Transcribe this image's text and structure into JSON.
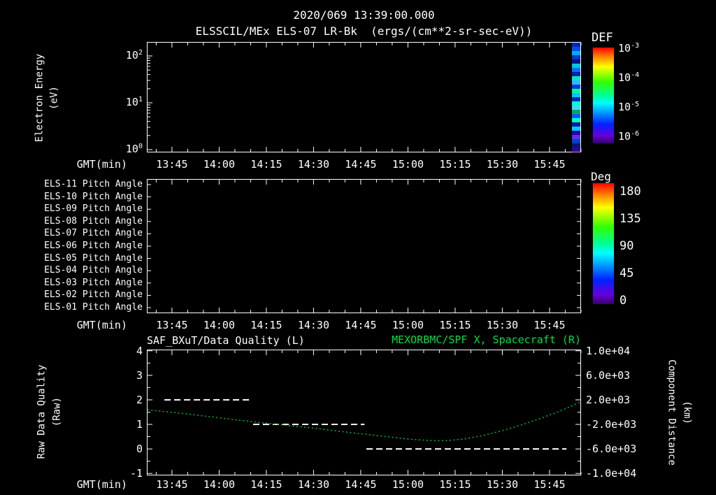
{
  "header": {
    "datetime": "2020/069 13:39:00.000",
    "title": "ELSSCIL/MEx ELS-07 LR-Bk  (ergs/(cm**2-sr-sec-eV))"
  },
  "colors": {
    "background": "#000000",
    "foreground": "#ffffff",
    "title_green": "#00e040",
    "curve_green": "#00b038",
    "rainbow_stops": [
      [
        "#ff0000",
        0
      ],
      [
        "#ff8800",
        10
      ],
      [
        "#ffff00",
        20
      ],
      [
        "#33ff00",
        36
      ],
      [
        "#00ff99",
        50
      ],
      [
        "#00ffff",
        58
      ],
      [
        "#0099ff",
        68
      ],
      [
        "#0022ff",
        80
      ],
      [
        "#6600dd",
        92
      ],
      [
        "#38006b",
        100
      ]
    ]
  },
  "x_axis": {
    "label": "GMT(min)",
    "tick_labels": [
      "13:45",
      "14:00",
      "14:15",
      "14:30",
      "14:45",
      "15:00",
      "15:15",
      "15:30",
      "15:45"
    ],
    "tick_hours": [
      13.75,
      14.0,
      14.25,
      14.5,
      14.75,
      15.0,
      15.25,
      15.5,
      15.75
    ],
    "start_hour": 13.617,
    "end_hour": 15.917
  },
  "spectrogram": {
    "ylabel_line1": "Electron Energy",
    "ylabel_line2": "(eV)",
    "ytick_exponents": [
      2,
      1,
      0
    ],
    "colorbar": {
      "title": "DEF",
      "tick_exponents": [
        -3,
        -4,
        -5,
        -6
      ]
    }
  },
  "pitch_panel": {
    "row_labels": [
      "ELS-11 Pitch Angle",
      "ELS-10 Pitch Angle",
      "ELS-09 Pitch Angle",
      "ELS-08 Pitch Angle",
      "ELS-07 Pitch Angle",
      "ELS-06 Pitch Angle",
      "ELS-05 Pitch Angle",
      "ELS-04 Pitch Angle",
      "ELS-03 Pitch Angle",
      "ELS-02 Pitch Angle",
      "ELS-01 Pitch Angle"
    ],
    "colorbar": {
      "title": "Deg",
      "tick_labels": [
        "180",
        "135",
        "90",
        "45",
        "0"
      ]
    }
  },
  "bottom_panel": {
    "left_title": "SAF_BXuT/Data Quality (L)",
    "right_title": "MEXORBMC/SPF X, Spacecraft (R)",
    "left_ylabel_line1": "Raw Data Quality",
    "left_ylabel_line2": "(Raw)",
    "right_ylabel_line1": "Component Distance",
    "right_ylabel_line2": "(km)",
    "left_ticks": [
      "4",
      "3",
      "2",
      "1",
      "0",
      "-1"
    ],
    "right_ticks": [
      "1.0e+04",
      "6.0e+03",
      "2.0e+03",
      "-2.0e+03",
      "-6.0e+03",
      "-1.0e+04"
    ]
  },
  "chart_data": {
    "energy_spectrogram": {
      "type": "heatmap",
      "title": "ELSSCIL/MEx ELS-07 LR-Bk (ergs/(cm**2-sr-sec-eV))",
      "ylabel": "Electron Energy (eV)",
      "y_scale": "log",
      "ytick_values": [
        1,
        10,
        100
      ],
      "colorbar_title": "DEF",
      "colorbar_tick_values": [
        "1e-3",
        "1e-4",
        "1e-5",
        "1e-6"
      ],
      "content": "panel empty except a narrow colored data strip at the right edge",
      "strip_hours": [
        15.86,
        15.91
      ],
      "strip_colors_top_to_bottom": [
        "#0028b0",
        "#0050e8",
        "#00a8ff",
        "#0038cc",
        "#001488",
        "#00c8e0",
        "#0070ff",
        "#0024a0",
        "#00e8c0",
        "#30b8ff",
        "#0040d8",
        "#00ff90",
        "#00c8ff",
        "#0030b8",
        "#00ffd0",
        "#40d8ff",
        "#00a860",
        "#0060ff",
        "#00ffc8",
        "#0020a0",
        "#00c8ff",
        "#2800a8",
        "#6030e8",
        "#0040cc",
        "#001870",
        "#3000a0"
      ]
    },
    "pitch_angle": {
      "type": "heatmap",
      "rows": 11,
      "colorbar_title": "Deg",
      "colorbar_tick_values": [
        180,
        135,
        90,
        45,
        0
      ],
      "content": "empty"
    },
    "quality_distance": {
      "type": "line",
      "xlabel": "GMT(min)",
      "x_range_hours": [
        13.617,
        15.917
      ],
      "left_axis": {
        "label": "Raw Data Quality (Raw)",
        "ylim": [
          -1.08,
          4.05
        ],
        "tick_values": [
          4,
          3,
          2,
          1,
          0,
          -1
        ]
      },
      "right_axis": {
        "label": "Component Distance (km)",
        "ylim": [
          -10320,
          10200
        ],
        "tick_values": [
          10000,
          6000,
          2000,
          -2000,
          -6000,
          -10000
        ]
      },
      "series": [
        {
          "name": "SAF_BXuT/Data Quality (L)",
          "axis": "left",
          "style": "dashed",
          "color": "#ffffff",
          "segments": [
            {
              "value": 2,
              "from_hour": 13.71,
              "to_hour": 14.16
            },
            {
              "value": 1,
              "from_hour": 14.18,
              "to_hour": 14.77
            },
            {
              "value": 0,
              "from_hour": 14.78,
              "to_hour": 15.84
            }
          ]
        },
        {
          "name": "MEXORBMC/SPF X, Spacecraft (R)",
          "axis": "right",
          "style": "dotted",
          "color": "#00b038",
          "points_hour_km": [
            [
              13.62,
              400
            ],
            [
              13.8,
              -200
            ],
            [
              13.9,
              -560
            ],
            [
              14.0,
              -920
            ],
            [
              14.12,
              -1360
            ],
            [
              14.25,
              -1800
            ],
            [
              14.37,
              -2200
            ],
            [
              14.5,
              -2600
            ],
            [
              14.62,
              -3060
            ],
            [
              14.75,
              -3520
            ],
            [
              14.87,
              -3940
            ],
            [
              15.0,
              -4380
            ],
            [
              15.07,
              -4540
            ],
            [
              15.15,
              -4660
            ],
            [
              15.22,
              -4600
            ],
            [
              15.3,
              -4380
            ],
            [
              15.4,
              -3800
            ],
            [
              15.5,
              -3020
            ],
            [
              15.6,
              -2100
            ],
            [
              15.7,
              -1050
            ],
            [
              15.8,
              100
            ],
            [
              15.92,
              1720
            ]
          ]
        }
      ]
    }
  }
}
